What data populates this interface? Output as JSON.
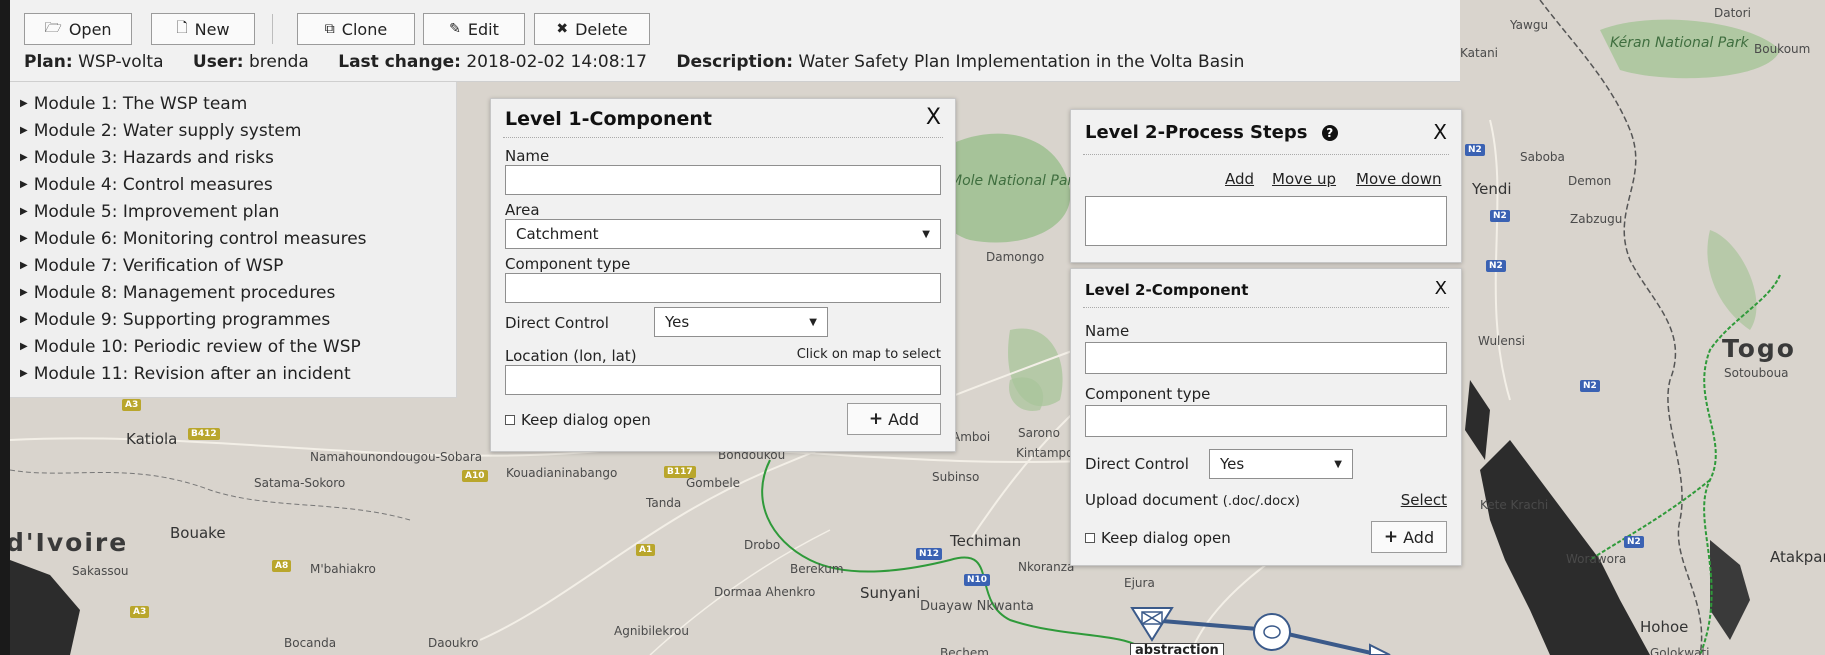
{
  "toolbar": {
    "open": "Open",
    "new": "New",
    "clone": "Clone",
    "edit": "Edit",
    "delete": "Delete"
  },
  "plan": {
    "plan_label": "Plan:",
    "plan_value": "WSP-volta",
    "user_label": "User:",
    "user_value": "brenda",
    "change_label": "Last change:",
    "change_value": "2018-02-02 14:08:17",
    "desc_label": "Description:",
    "desc_value": "Water Safety Plan Implementation in the Volta Basin"
  },
  "modules": [
    "Module 1: The WSP team",
    "Module 2: Water supply system",
    "Module 3: Hazards and risks",
    "Module 4: Control measures",
    "Module 5: Improvement plan",
    "Module 6: Monitoring control measures",
    "Module 7: Verification of WSP",
    "Module 8: Management procedures",
    "Module 9: Supporting programmes",
    "Module 10: Periodic review of the WSP",
    "Module 11: Revision after an incident"
  ],
  "level1": {
    "title": "Level 1-Component",
    "close": "X",
    "name_label": "Name",
    "name_value": "",
    "area_label": "Area",
    "area_value": "Catchment",
    "type_label": "Component type",
    "type_value": "",
    "direct_label": "Direct Control",
    "direct_value": "Yes",
    "location_label": "Location (lon, lat)",
    "location_hint": "Click on map to select",
    "location_value": "",
    "keep_open": "Keep dialog open",
    "add": "Add"
  },
  "process_steps": {
    "title": "Level 2-Process Steps",
    "close": "X",
    "add": "Add",
    "move_up": "Move up",
    "move_down": "Move down"
  },
  "level2": {
    "title": "Level 2-Component",
    "close": "X",
    "name_label": "Name",
    "name_value": "",
    "type_label": "Component type",
    "type_value": "",
    "direct_label": "Direct Control",
    "direct_value": "Yes",
    "upload_label": "Upload document",
    "upload_ext": "(.doc/.docx)",
    "select": "Select",
    "keep_open": "Keep dialog open",
    "add": "Add"
  },
  "map": {
    "places": [
      "Yawgu",
      "Datori",
      "Kéran National Park",
      "Boukoum",
      "Katani",
      "Saboba",
      "Yendi",
      "Demon",
      "Zabzugu",
      "Mole National Park",
      "Damongo",
      "Togo",
      "Sotouboua",
      "Wulensi",
      "Katiola",
      "Namahounondougou-Sobara",
      "Kouadianinabango",
      "Satama-Sokoro",
      "Bondoukou",
      "Gombele",
      "Tanda",
      "Subinso",
      "Kintampo",
      "Sarono",
      "Amboi",
      "d'Ivoire",
      "Bouake",
      "Sakassou",
      "M'bahiakro",
      "Drobo",
      "Berekum",
      "Techiman",
      "Nkoranza",
      "Sunyani",
      "Dormaa Ahenkro",
      "Duayaw Nkwanta",
      "Agnibilekrou",
      "Ejura",
      "Bocanda",
      "Daoukro",
      "Bechem",
      "Kete Krachi",
      "Worawora",
      "Atakpamé",
      "Hohoe",
      "Golokwati"
    ],
    "roads": [
      "A3",
      "B412",
      "A10",
      "B117",
      "A1",
      "A8",
      "A3",
      "N12",
      "N10",
      "N2",
      "N2",
      "N2",
      "N2",
      "N2"
    ],
    "node_label": "abstraction"
  }
}
